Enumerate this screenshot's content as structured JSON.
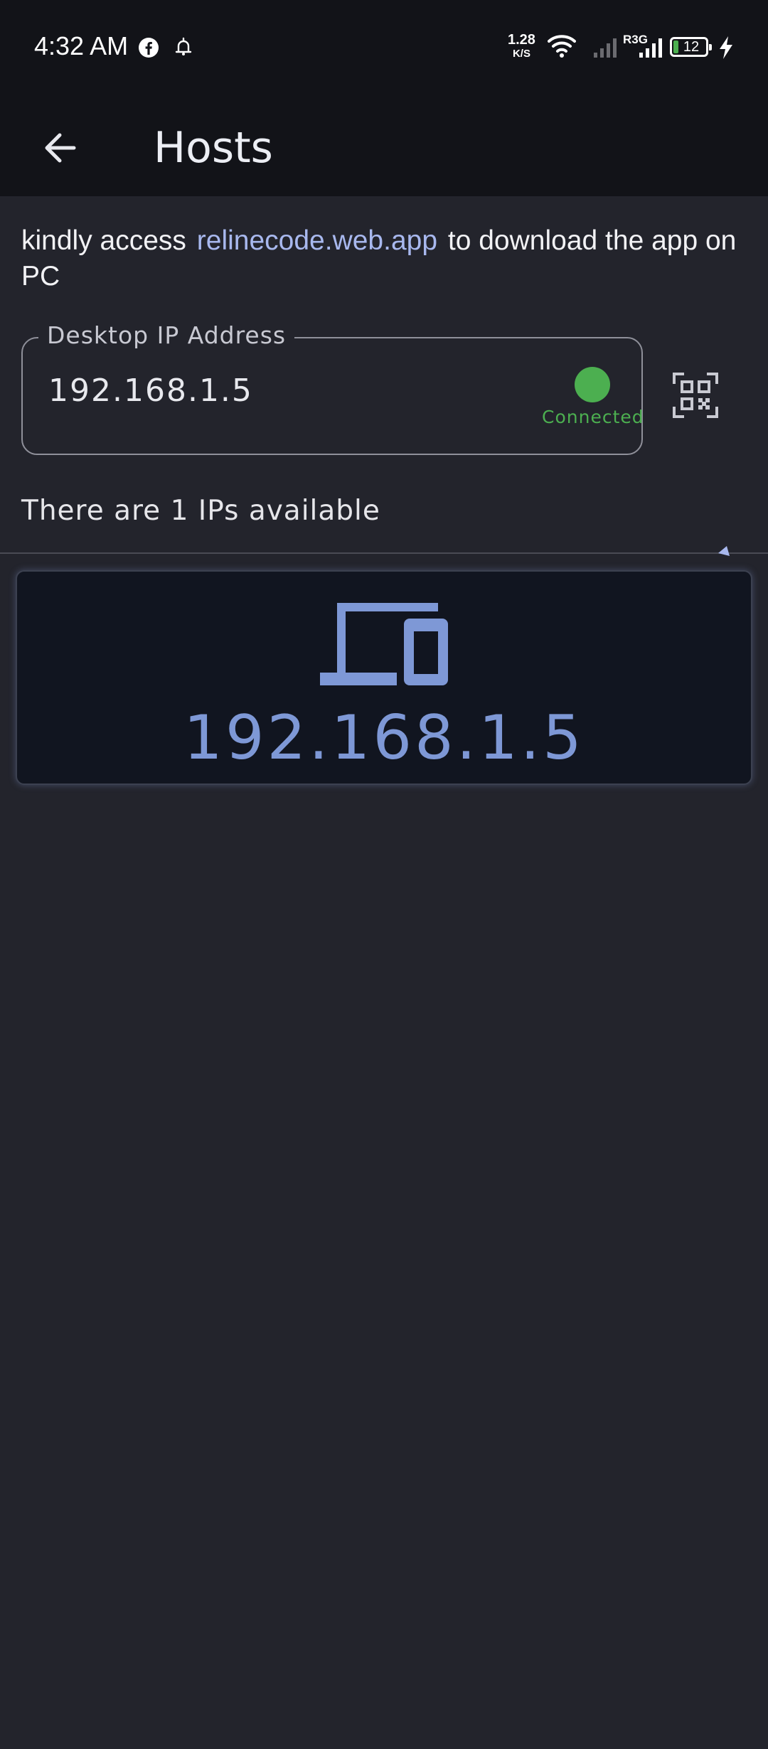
{
  "status_bar": {
    "time": "4:32 AM",
    "net_speed_value": "1.28",
    "net_speed_unit": "K/S",
    "network_type": "R3G",
    "battery_level": "12",
    "icons": [
      "facebook-icon",
      "notification-bell-icon",
      "wifi-icon",
      "signal-weak-icon",
      "signal-strong-icon",
      "battery-icon",
      "charging-bolt-icon"
    ]
  },
  "app_bar": {
    "back_icon": "arrow-left-icon",
    "title": "Hosts"
  },
  "info": {
    "prefix": "kindly access",
    "link": "relinecode.web.app",
    "suffix": "to download the app on PC"
  },
  "ip_field": {
    "label": "Desktop IP Address",
    "value": "192.168.1.5",
    "status": "Connected",
    "status_color": "#4caf50"
  },
  "qr_button": {
    "icon": "qr-scan-icon"
  },
  "hosts": {
    "available_text": "There are 1 IPs available",
    "items": [
      {
        "ip": "192.168.1.5",
        "icon": "devices-icon"
      }
    ]
  },
  "colors": {
    "background": "#23242c",
    "app_bar": "#121318",
    "accent": "#7e98d6",
    "link": "#a8b8ee",
    "card": "#111520"
  }
}
